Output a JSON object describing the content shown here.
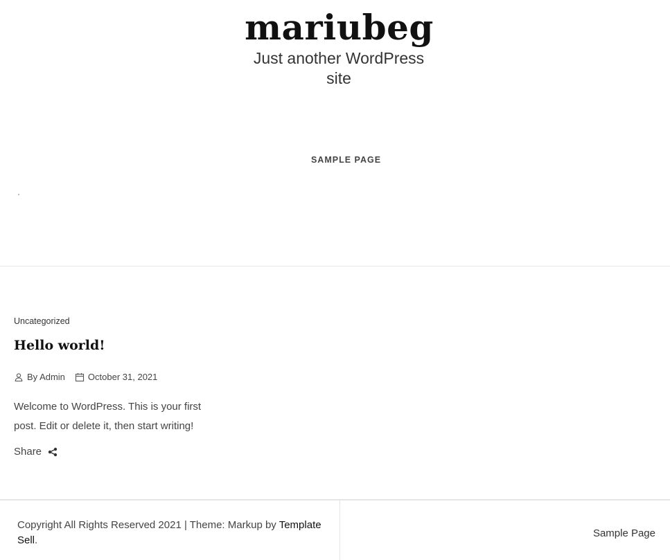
{
  "header": {
    "site_title": "mariubeg",
    "tagline": "Just another WordPress site"
  },
  "nav": {
    "items": [
      {
        "label": "SAMPLE PAGE"
      }
    ]
  },
  "post": {
    "category": "Uncategorized",
    "title": "Hello world!",
    "author": "By Admin",
    "date": "October 31, 2021",
    "excerpt": "Welcome to WordPress. This is your first post. Edit or delete it, then start writing!",
    "share_label": "Share",
    "icons": {
      "author": "user-icon",
      "date": "calendar-icon",
      "share": "share-icon"
    }
  },
  "footer": {
    "copyright": "Copyright All Rights Reserved 2021 | Theme: Markup by",
    "credit_link": "Template Sell",
    "credit_suffix": ".",
    "nav_link": "Sample Page"
  }
}
